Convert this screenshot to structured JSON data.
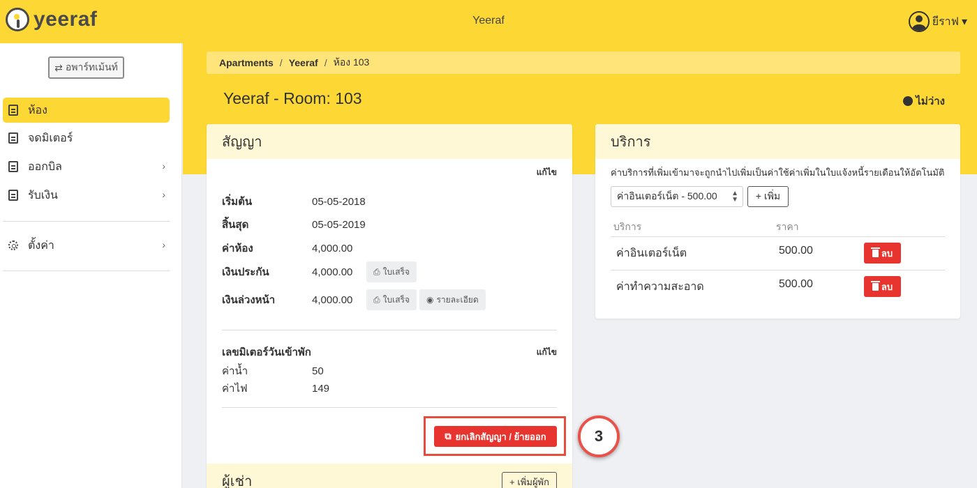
{
  "topbar": {
    "logo": "yeeraf",
    "title": "Yeeraf",
    "user": "ยีราฟ",
    "caret": "▾"
  },
  "sidebar": {
    "apartment_button": "อพาร์ทเม้นท์",
    "items": [
      {
        "label": "ห้อง",
        "active": true
      },
      {
        "label": "จดมิเตอร์"
      },
      {
        "label": "ออกบิล",
        "chevron": "›"
      },
      {
        "label": "รับเงิน",
        "chevron": "›"
      },
      {
        "label": "ตั้งค่า",
        "chevron": "›"
      }
    ]
  },
  "breadcrumb": [
    "Apartments",
    "Yeeraf",
    "ห้อง 103"
  ],
  "breadcrumb_sep": "/",
  "room": {
    "title": "Yeeraf - Room: 103",
    "status": "ไม่ว่าง"
  },
  "contract": {
    "heading": "สัญญา",
    "edit": "แก้ไข",
    "rows": [
      {
        "label": "เริ่มต้น",
        "value": "05-05-2018"
      },
      {
        "label": "สิ้นสุด",
        "value": "05-05-2019"
      },
      {
        "label": "ค่าห้อง",
        "value": "4,000.00"
      },
      {
        "label": "เงินประกัน",
        "value": "4,000.00"
      },
      {
        "label": "เงินล่วงหน้า",
        "value": "4,000.00"
      }
    ],
    "receipt_label": "ใบเสร็จ",
    "detail_label": "รายละเอียด",
    "meter_heading": "เลขมิเตอร์วันเข้าพัก",
    "meter_edit": "แก้ไข",
    "meters": [
      {
        "label": "ค่าน้ำ",
        "value": "50"
      },
      {
        "label": "ค่าไฟ",
        "value": "149"
      }
    ],
    "cancel_button": "ยกเลิกสัญญา / ย้ายออก"
  },
  "tenant": {
    "heading": "ผู้เช่า",
    "add_button": "+ เพิ่มผู้พัก"
  },
  "step_marker": "3",
  "service": {
    "heading": "บริการ",
    "description": "ค่าบริการที่เพิ่มเข้ามาจะถูกนำไปเพิ่มเป็นค่าใช้ค่าเพิ่มในใบแจ้งหนี้รายเดือนให้อัตโนมัติ",
    "select_value": "ค่าอินเตอร์เน็ต - 500.00",
    "add_button": "+ เพิ่ม",
    "columns": [
      "บริการ",
      "ราคา"
    ],
    "rows": [
      {
        "name": "ค่าอินเตอร์เน็ต",
        "price": "500.00"
      },
      {
        "name": "ค่าทำความสะอาด",
        "price": "500.00"
      }
    ],
    "delete_label": "ลบ"
  },
  "colors": {
    "brand_yellow": "#fdd835",
    "danger": "#e8342e",
    "header_tint": "#fff8d6"
  }
}
